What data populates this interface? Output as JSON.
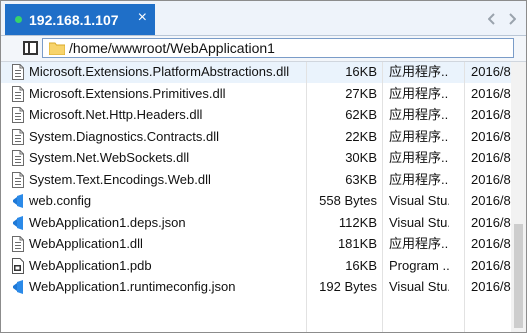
{
  "tab": {
    "title": "192.168.1.107",
    "close_icon": "×"
  },
  "path": {
    "value": "/home/wwwroot/WebApplication1"
  },
  "colors": {
    "tab_active": "#1f6fc8",
    "status_dot": "#37d36b",
    "selected_row": "#eaf3fc"
  },
  "files": [
    {
      "name": "Microsoft.Extensions.PlatformAbstractions.dll",
      "size": "16KB",
      "type": "应用程序...",
      "date": "2016/8",
      "icon": "dll-file-icon"
    },
    {
      "name": "Microsoft.Extensions.Primitives.dll",
      "size": "27KB",
      "type": "应用程序...",
      "date": "2016/8",
      "icon": "dll-file-icon"
    },
    {
      "name": "Microsoft.Net.Http.Headers.dll",
      "size": "62KB",
      "type": "应用程序...",
      "date": "2016/8",
      "icon": "dll-file-icon"
    },
    {
      "name": "System.Diagnostics.Contracts.dll",
      "size": "22KB",
      "type": "应用程序...",
      "date": "2016/8",
      "icon": "dll-file-icon"
    },
    {
      "name": "System.Net.WebSockets.dll",
      "size": "30KB",
      "type": "应用程序...",
      "date": "2016/8",
      "icon": "dll-file-icon"
    },
    {
      "name": "System.Text.Encodings.Web.dll",
      "size": "63KB",
      "type": "应用程序...",
      "date": "2016/8",
      "icon": "dll-file-icon"
    },
    {
      "name": "web.config",
      "size": "558 Bytes",
      "type": "Visual Stu...",
      "date": "2016/8",
      "icon": "visual-studio-icon"
    },
    {
      "name": "WebApplication1.deps.json",
      "size": "112KB",
      "type": "Visual Stu...",
      "date": "2016/8",
      "icon": "visual-studio-icon"
    },
    {
      "name": "WebApplication1.dll",
      "size": "181KB",
      "type": "应用程序...",
      "date": "2016/8",
      "icon": "dll-file-icon"
    },
    {
      "name": "WebApplication1.pdb",
      "size": "16KB",
      "type": "Program ...",
      "date": "2016/8",
      "icon": "pdb-file-icon"
    },
    {
      "name": "WebApplication1.runtimeconfig.json",
      "size": "192 Bytes",
      "type": "Visual Stu...",
      "date": "2016/8",
      "icon": "visual-studio-icon"
    }
  ]
}
